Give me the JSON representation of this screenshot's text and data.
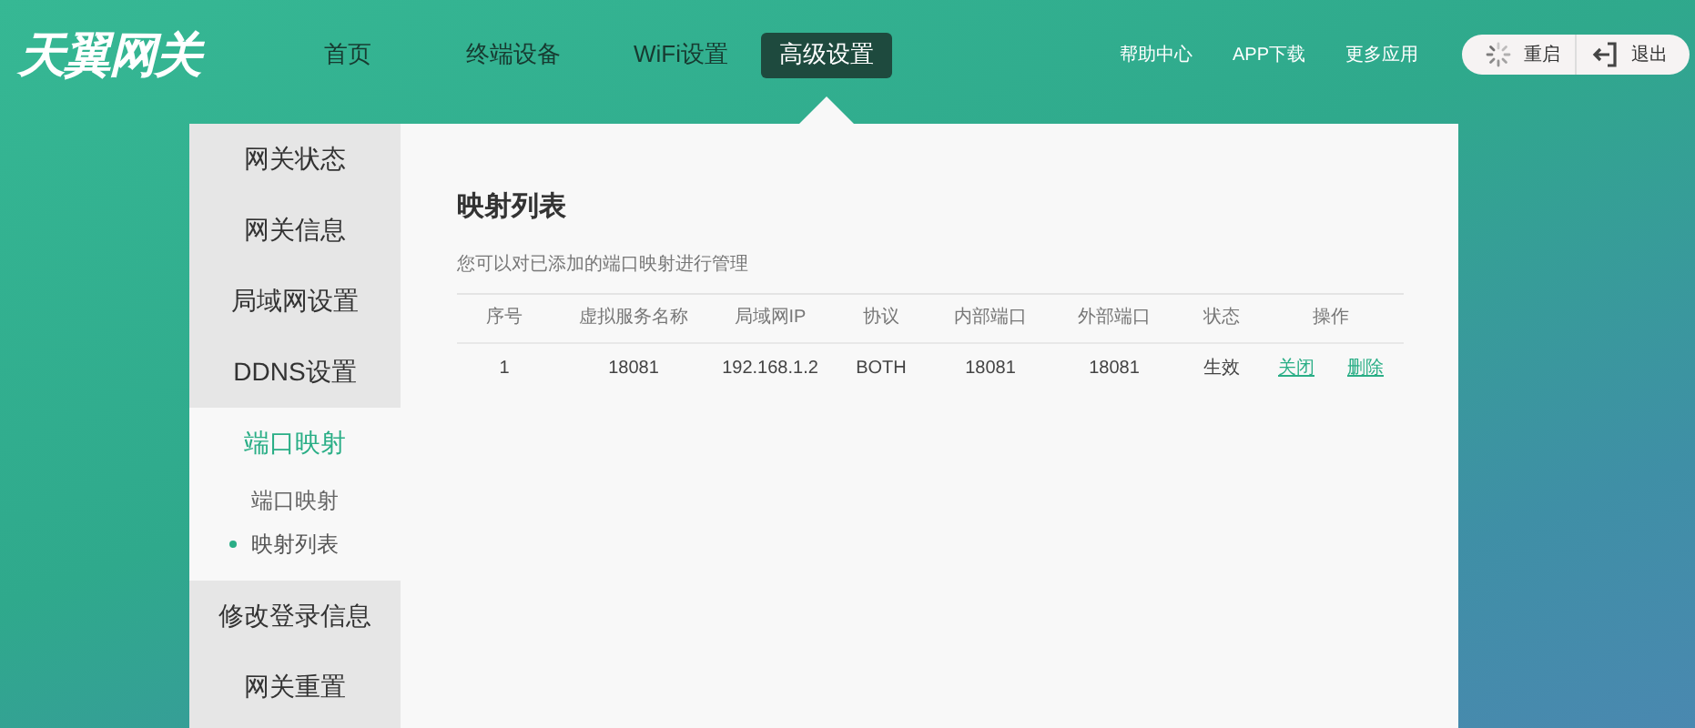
{
  "logo": "天翼网关",
  "nav": [
    {
      "label": "首页",
      "selected": false
    },
    {
      "label": "终端设备",
      "selected": false
    },
    {
      "label": "WiFi设置",
      "selected": false
    },
    {
      "label": "高级设置",
      "selected": true
    }
  ],
  "links": [
    "帮助中心",
    "APP下载",
    "更多应用"
  ],
  "actions": [
    {
      "kind": "restart",
      "label": "重启"
    },
    {
      "kind": "logout",
      "label": "退出"
    }
  ],
  "sidebar": {
    "items": [
      {
        "label": "网关状态",
        "selected": false
      },
      {
        "label": "网关信息",
        "selected": false
      },
      {
        "label": "局域网设置",
        "selected": false
      },
      {
        "label": "DDNS设置",
        "selected": false
      },
      {
        "label": "端口映射",
        "selected": true,
        "expanded": true,
        "children": [
          {
            "label": "端口映射",
            "selected": false
          },
          {
            "label": "映射列表",
            "selected": true
          }
        ]
      },
      {
        "label": "修改登录信息",
        "selected": false
      },
      {
        "label": "网关重置",
        "selected": false
      }
    ]
  },
  "content": {
    "title": "映射列表",
    "description": "您可以对已添加的端口映射进行管理",
    "table": {
      "columns": [
        "序号",
        "虚拟服务名称",
        "局域网IP",
        "协议",
        "内部端口",
        "外部端口",
        "状态",
        "操作"
      ],
      "rows": [
        {
          "cells": [
            "1",
            "18081",
            "192.168.1.2",
            "BOTH",
            "18081",
            "18081",
            "生效"
          ],
          "actions": [
            "关闭",
            "删除"
          ]
        }
      ]
    }
  }
}
